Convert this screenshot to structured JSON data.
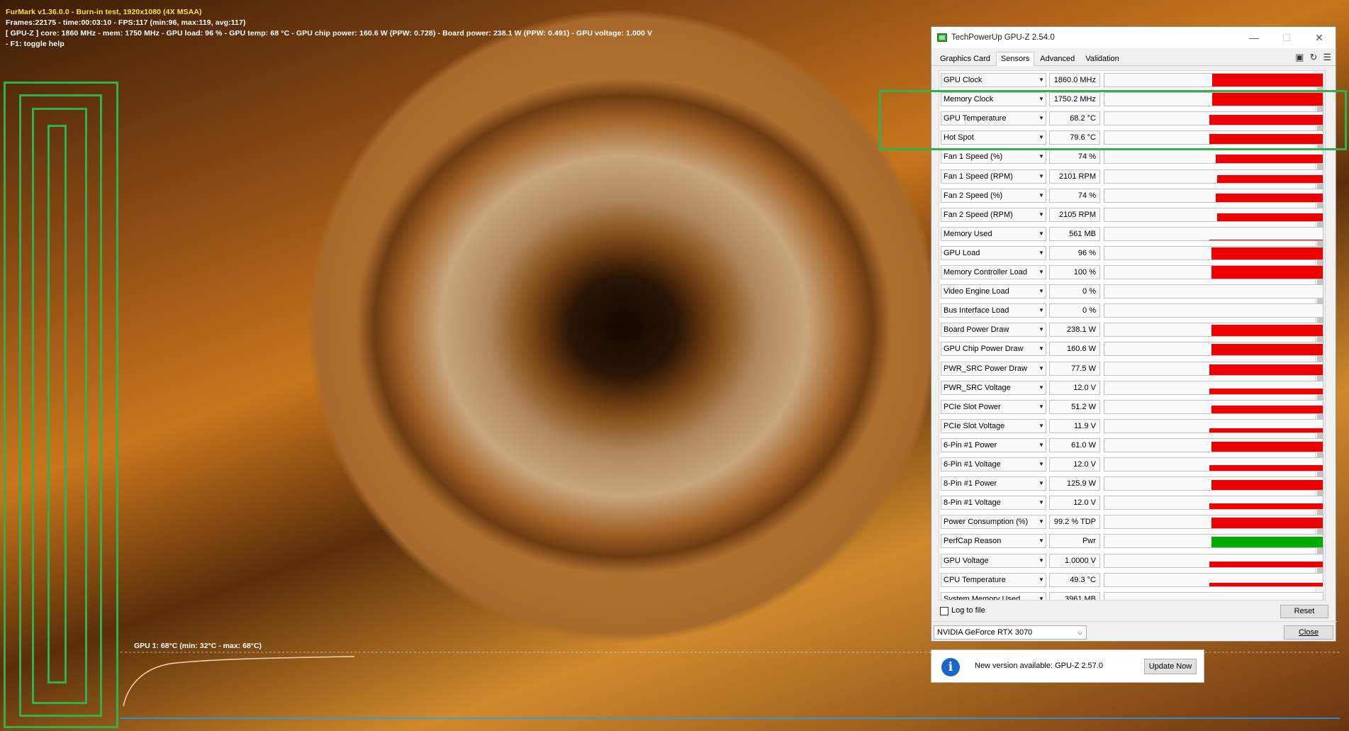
{
  "furmark": {
    "line1": "FurMark v1.36.0.0 - Burn-in test, 1920x1080 (4X MSAA)",
    "line2": "Frames:22175 - time:00:03:10 - FPS:117 (min:96, max:119, avg:117)",
    "line3": "[ GPU-Z ] core: 1860 MHz - mem: 1750 MHz - GPU load: 96 % - GPU temp: 68 °C - GPU chip power: 160.6 W (PPW: 0.728) - Board power: 238.1 W (PPW: 0.491) - GPU voltage: 1.000 V",
    "line4": "- F1: toggle help",
    "temp_graph_label": "GPU 1: 68°C (min: 32°C - max: 68°C)"
  },
  "gpuz": {
    "title": "TechPowerUp GPU-Z 2.54.0",
    "tabs": [
      "Graphics Card",
      "Sensors",
      "Advanced",
      "Validation"
    ],
    "active_tab": "Sensors",
    "sensors": [
      {
        "name": "GPU Clock",
        "value": "1860.0 MHz",
        "level": 0.99,
        "start": 0.05
      },
      {
        "name": "Memory Clock",
        "value": "1750.2 MHz",
        "level": 0.99,
        "start": 0.05
      },
      {
        "name": "GPU Temperature",
        "value": "68.2 °C",
        "level": 0.75,
        "start": 0.0
      },
      {
        "name": "Hot Spot",
        "value": "79.6 °C",
        "level": 0.75,
        "start": 0.0
      },
      {
        "name": "Fan 1 Speed (%)",
        "value": "74 %",
        "level": 0.65,
        "start": 0.1
      },
      {
        "name": "Fan 1 Speed (RPM)",
        "value": "2101 RPM",
        "level": 0.6,
        "start": 0.12
      },
      {
        "name": "Fan 2 Speed (%)",
        "value": "74 %",
        "level": 0.65,
        "start": 0.1
      },
      {
        "name": "Fan 2 Speed (RPM)",
        "value": "2105 RPM",
        "level": 0.6,
        "start": 0.12
      },
      {
        "name": "Memory Used",
        "value": "561 MB",
        "level": 0.05,
        "start": 0.0
      },
      {
        "name": "GPU Load",
        "value": "96 %",
        "level": 0.96,
        "start": 0.03
      },
      {
        "name": "Memory Controller Load",
        "value": "100 %",
        "level": 0.99,
        "start": 0.03
      },
      {
        "name": "Video Engine Load",
        "value": "0 %",
        "level": 0,
        "start": 0
      },
      {
        "name": "Bus Interface Load",
        "value": "0 %",
        "level": 0,
        "start": 0
      },
      {
        "name": "Board Power Draw",
        "value": "238.1 W",
        "level": 0.9,
        "start": 0.03
      },
      {
        "name": "GPU Chip Power Draw",
        "value": "160.6 W",
        "level": 0.9,
        "start": 0.03
      },
      {
        "name": "PWR_SRC Power Draw",
        "value": "77.5 W",
        "level": 0.85,
        "start": 0.0
      },
      {
        "name": "PWR_SRC Voltage",
        "value": "12.0 V",
        "level": 0.45,
        "start": 0.0
      },
      {
        "name": "PCIe Slot Power",
        "value": "51.2 W",
        "level": 0.6,
        "start": 0.03
      },
      {
        "name": "PCIe Slot Voltage",
        "value": "11.9 V",
        "level": 0.35,
        "start": 0.0
      },
      {
        "name": "6-Pin #1 Power",
        "value": "61.0 W",
        "level": 0.75,
        "start": 0.03
      },
      {
        "name": "6-Pin #1 Voltage",
        "value": "12.0 V",
        "level": 0.45,
        "start": 0.0
      },
      {
        "name": "8-Pin #1 Power",
        "value": "125.9 W",
        "level": 0.8,
        "start": 0.03
      },
      {
        "name": "8-Pin #1 Voltage",
        "value": "12.0 V",
        "level": 0.45,
        "start": 0.0
      },
      {
        "name": "Power Consumption (%)",
        "value": "99.2 % TDP",
        "level": 0.85,
        "start": 0.03
      },
      {
        "name": "PerfCap Reason",
        "value": "Pwr",
        "level": 0.85,
        "start": 0.03,
        "color": "#00aa00"
      },
      {
        "name": "GPU Voltage",
        "value": "1.0000 V",
        "level": 0.45,
        "start": 0.0
      },
      {
        "name": "CPU Temperature",
        "value": "49.3 °C",
        "level": 0.3,
        "start": 0.0
      },
      {
        "name": "System Memory Used",
        "value": "3961 MB",
        "level": 0.08,
        "start": 0.0
      }
    ],
    "log_label": "Log to file",
    "reset_label": "Reset",
    "gpu_name": "NVIDIA GeForce RTX 3070",
    "close_label": "Close"
  },
  "notification": {
    "text": "New version available: GPU-Z 2.57.0",
    "button": "Update Now"
  },
  "colors": {
    "sensor_bar": "#ee0000",
    "perfcap_bar": "#00aa00",
    "highlight": "#2fb24c"
  }
}
